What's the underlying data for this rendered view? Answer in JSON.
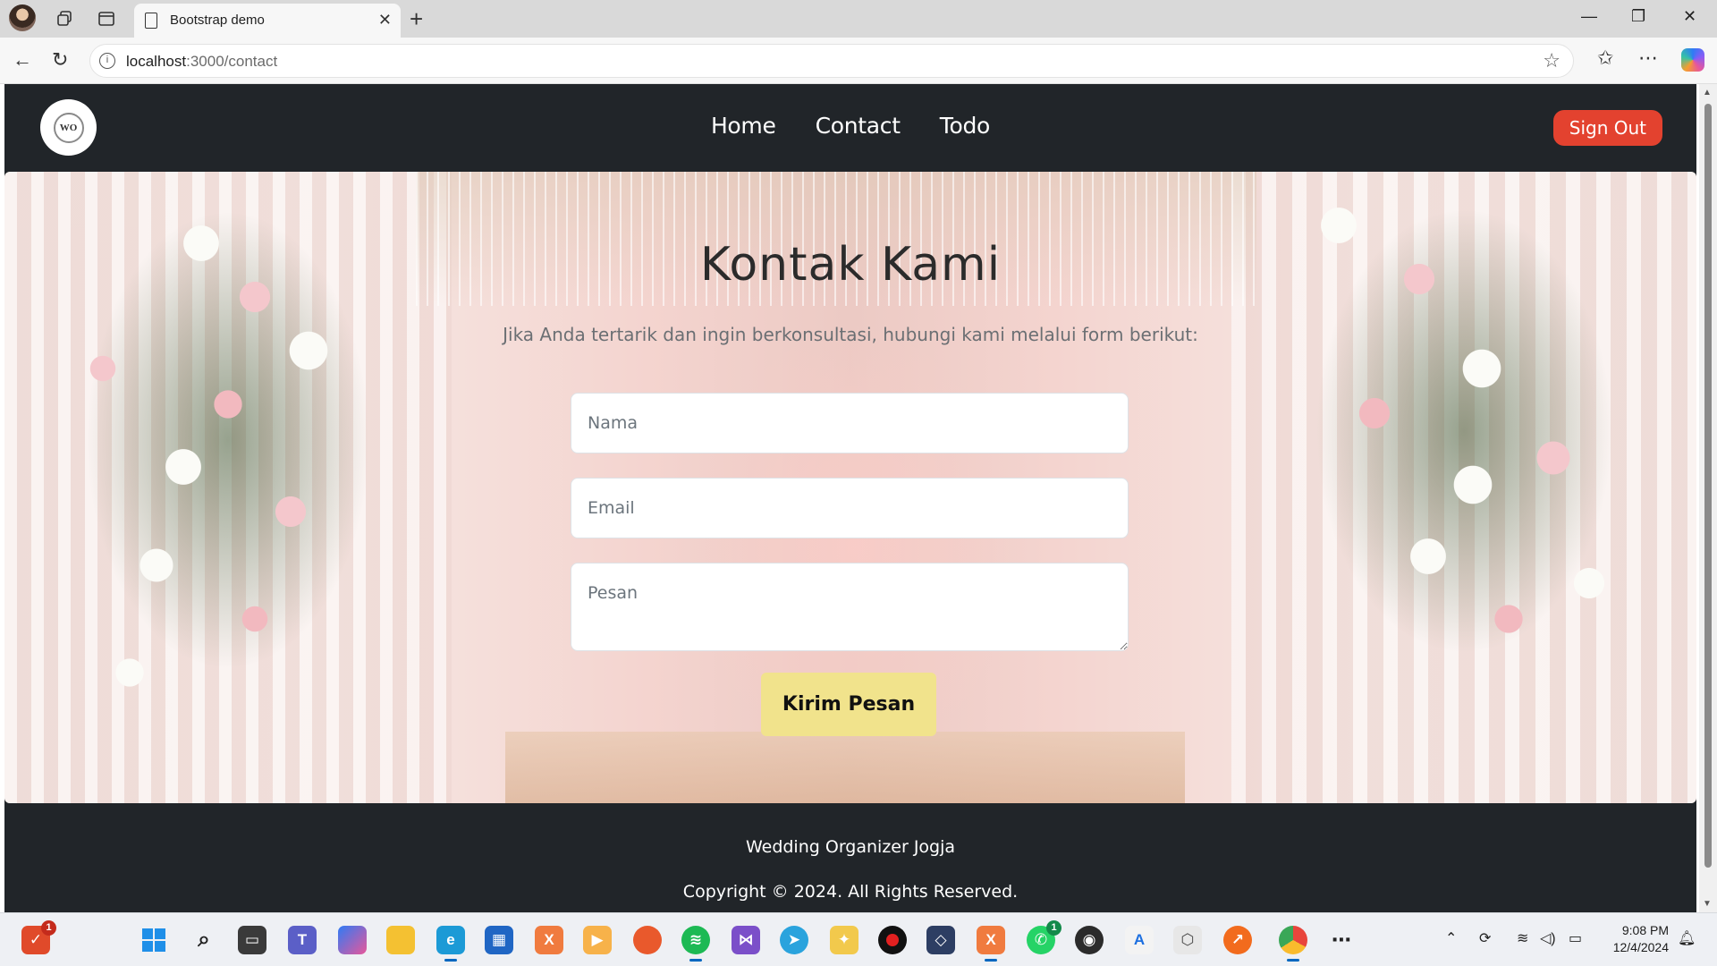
{
  "browser": {
    "tab_title": "Bootstrap demo",
    "tab_close": "✕",
    "new_tab": "+",
    "url_host": "localhost",
    "url_path": ":3000/contact",
    "window": {
      "minimize": "—",
      "restore": "❐",
      "close": "✕"
    }
  },
  "navbar": {
    "logo_text": "WO",
    "links": [
      "Home",
      "Contact",
      "Todo"
    ],
    "signout_label": "Sign Out"
  },
  "hero": {
    "title": "Kontak Kami",
    "subtitle": "Jika Anda tertarik dan ingin berkonsultasi, hubungi kami melalui form berikut:",
    "form": {
      "name_placeholder": "Nama",
      "email_placeholder": "Email",
      "message_placeholder": "Pesan",
      "submit_label": "Kirim Pesan"
    }
  },
  "footer": {
    "brand": "Wedding Organizer Jogja",
    "copyright": "Copyright © 2024. All Rights Reserved."
  },
  "taskbar": {
    "clock_time": "9:08 PM",
    "clock_date": "12/4/2024",
    "badges": {
      "first_app": "1",
      "whatsapp": "1"
    },
    "accent": "#0067c0"
  },
  "colors": {
    "navbar_bg": "#212529",
    "signout_bg": "#e3422f",
    "submit_bg": "#f1e38c"
  }
}
